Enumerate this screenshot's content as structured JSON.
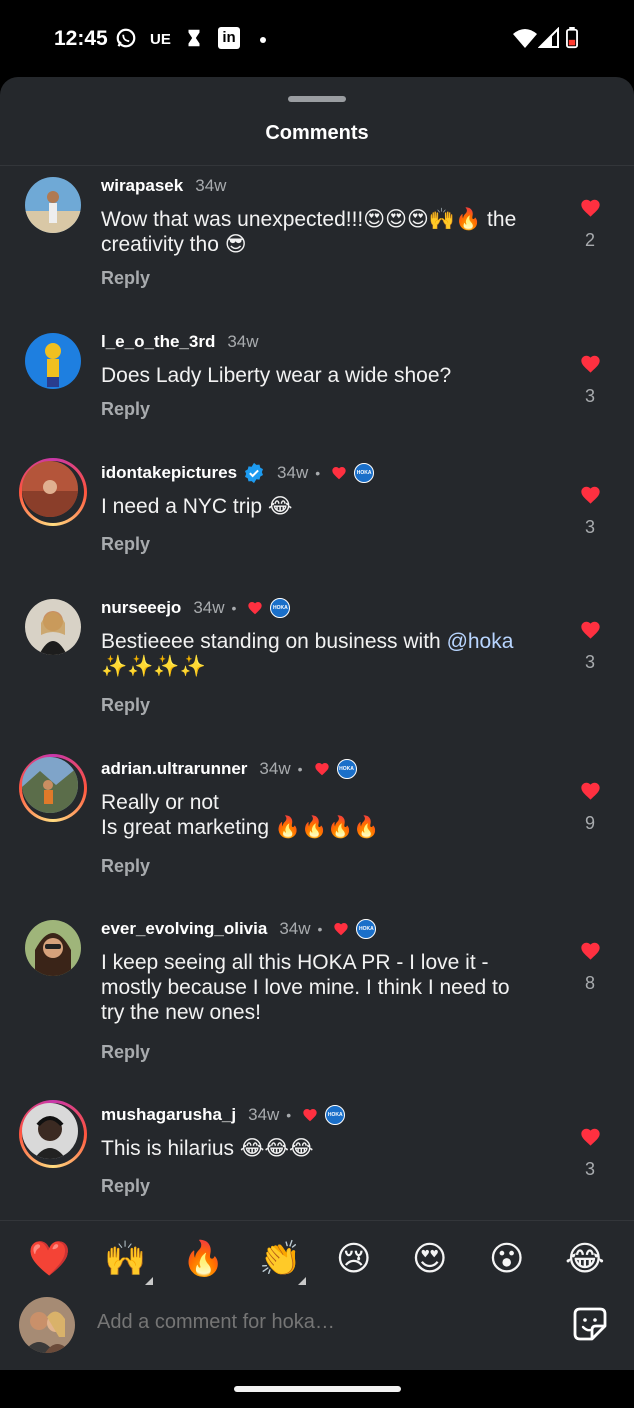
{
  "status_bar": {
    "time": "12:45",
    "whatsapp_icon": "whatsapp-icon",
    "carrier_text": "UE",
    "linkedin_text": "in",
    "wifi_icon": "wifi-icon",
    "signal_icon": "signal-icon",
    "battery_icon": "battery-icon"
  },
  "sheet": {
    "title": "Comments"
  },
  "comments": [
    {
      "username": "wirapasek",
      "age": "34w",
      "text": "Wow that was unexpected!!!😍😍😍🙌🔥 the creativity tho 😎",
      "reply_label": "Reply",
      "like_count": "2",
      "liked_by_creator": false,
      "verified": false
    },
    {
      "username": "l_e_o_the_3rd",
      "age": "34w",
      "text": "Does Lady Liberty wear a wide shoe?",
      "reply_label": "Reply",
      "like_count": "3",
      "liked_by_creator": false,
      "verified": false
    },
    {
      "username": "idontakepictures",
      "age": "34w",
      "sep": "•",
      "text": "I need a NYC trip 😂",
      "reply_label": "Reply",
      "like_count": "3",
      "liked_by_creator": true,
      "verified": true
    },
    {
      "username": "nurseeejo",
      "age": "34w",
      "sep": "•",
      "text_before": "Bestieeee standing on business with ",
      "mention": "@hoka",
      "text_after": " ✨✨✨✨",
      "reply_label": "Reply",
      "like_count": "3",
      "liked_by_creator": true,
      "verified": false
    },
    {
      "username": "adrian.ultrarunner",
      "age": "34w",
      "sep": "•",
      "text_line1": "Really or not",
      "text_line2": "Is great marketing 🔥🔥🔥🔥",
      "reply_label": "Reply",
      "like_count": "9",
      "liked_by_creator": true,
      "verified": false
    },
    {
      "username": "ever_evolving_olivia",
      "age": "34w",
      "sep": "•",
      "text": "I keep seeing all this HOKA PR - I love it - mostly because I love mine. I think I need to try the new ones!",
      "reply_label": "Reply",
      "like_count": "8",
      "liked_by_creator": true,
      "verified": false
    },
    {
      "username": "mushagarusha_j",
      "age": "34w",
      "sep": "•",
      "text": "This is hilarius 😂😂😂",
      "reply_label": "Reply",
      "like_count": "3",
      "liked_by_creator": true,
      "verified": false
    }
  ],
  "creator_badge": "HOKA",
  "reactions": [
    "❤️",
    "🙌",
    "🔥",
    "👏",
    "😢",
    "😍",
    "😮",
    "😂"
  ],
  "composer": {
    "placeholder": "Add a comment for hoka…",
    "sticker_icon": "sticker-icon"
  },
  "colors": {
    "background": "#25282c",
    "like_red": "#ff3040",
    "mention_blue": "#b8d5ff",
    "verified_blue": "#1d9bf0"
  }
}
